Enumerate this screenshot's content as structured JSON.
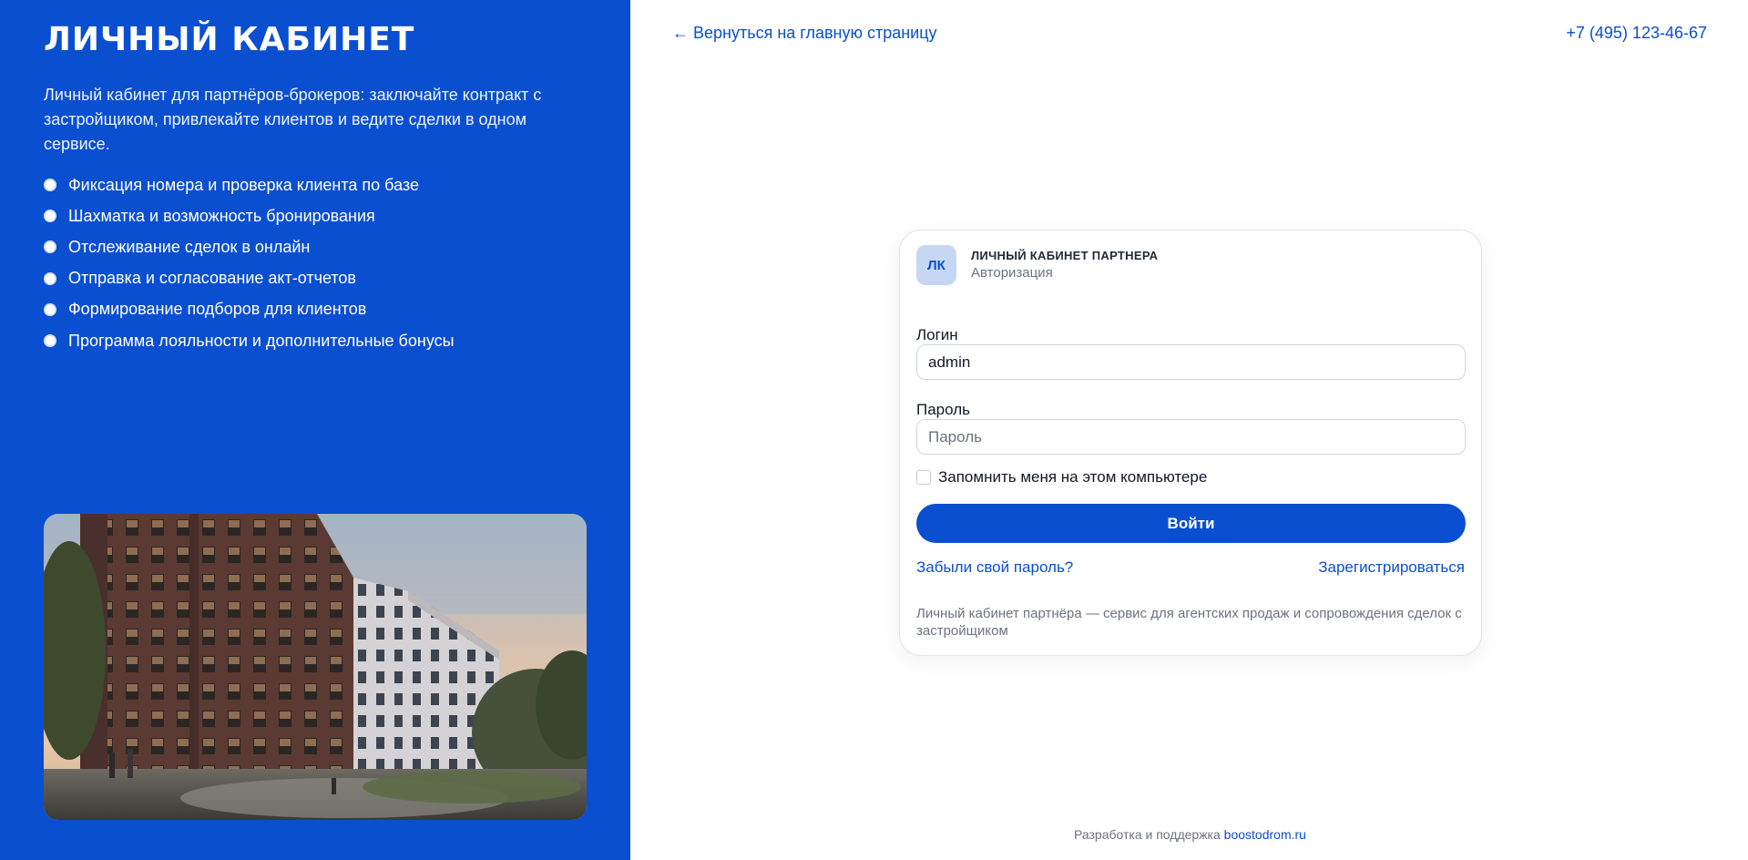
{
  "left_panel": {
    "title": "ЛИЧНЫЙ КАБИНЕТ",
    "intro": "Личный кабинет для партнёров-брокеров: заключайте контракт с застройщиком, привлекайте клиентов и ведите сделки в одном сервисе.",
    "features": [
      "Фиксация номера и проверка клиента по базе",
      "Шахматка и возможность бронирования",
      "Отслеживание сделок в онлайн",
      "Отправка и согласование акт-отчетов",
      "Формирование подборов для клиентов",
      "Программа лояльности и дополнительные бонусы"
    ],
    "background_color": "#0a4fd0"
  },
  "top_bar": {
    "back_link": "← Вернуться на главную страницу",
    "phone": "+7 (495) 123-46-67"
  },
  "login_card": {
    "badge": "ЛК",
    "title": "ЛИЧНЫЙ КАБИНЕТ ПАРТНЕРА",
    "subtitle": "Авторизация",
    "login_label": "Логин",
    "login_value": "admin",
    "password_label": "Пароль",
    "password_placeholder": "Пароль",
    "remember_label": "Запомнить меня на этом компьютере",
    "remember_checked": false,
    "submit_label": "Войти",
    "forgot_link": "Забыли свой пароль?",
    "register_link": "Зарегистрироваться",
    "note": "Личный кабинет партнёра — сервис для агентских продаж и сопровождения сделок с застройщиком"
  },
  "footer": {
    "text": "Разработка и поддержка",
    "link": "boostodrom.ru"
  },
  "colors": {
    "accent": "#0a4fd0",
    "badge_bg": "#c7d7f3"
  }
}
